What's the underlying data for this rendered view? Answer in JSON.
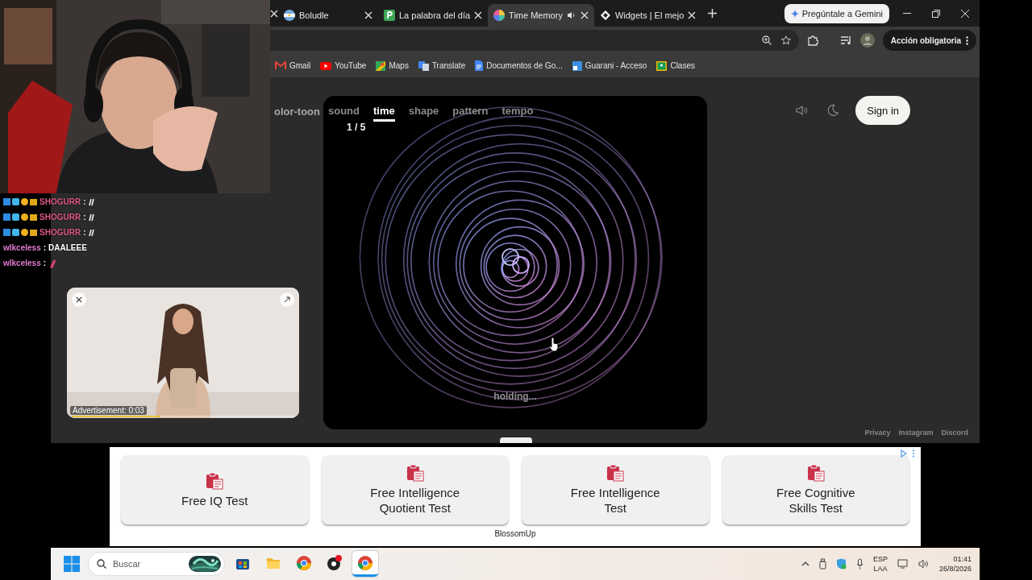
{
  "browser": {
    "tabs": [
      {
        "title": "Boludle",
        "selected": false,
        "audio": false
      },
      {
        "title": "La palabra del día",
        "selected": false,
        "audio": false
      },
      {
        "title": "Time Memory",
        "selected": true,
        "audio": true
      },
      {
        "title": "Widgets | El mejo",
        "selected": false,
        "audio": false
      }
    ],
    "gemini": "Pregúntale a Gemini",
    "action": "Acción obligatoria",
    "bookmarks": [
      "Gmail",
      "YouTube",
      "Maps",
      "Translate",
      "Documentos de Go...",
      "Guarani - Acceso",
      "Clases"
    ]
  },
  "game": {
    "logo": "olor-toon",
    "modes": [
      {
        "label": "sound",
        "selected": false
      },
      {
        "label": "time",
        "selected": true
      },
      {
        "label": "shape",
        "selected": false
      },
      {
        "label": "pattern",
        "selected": false
      },
      {
        "label": "tempo",
        "selected": false
      }
    ],
    "counter": "1 / 5",
    "status": "holding...",
    "sign_in": "Sign in",
    "footer_links": [
      "Privacy",
      "Instagram",
      "Discord"
    ]
  },
  "chat": [
    {
      "user": "SHOGURR",
      "separator": ":",
      "color": "#e0588a",
      "badges": true,
      "kind": "emote"
    },
    {
      "user": "SHOGURR",
      "separator": ":",
      "color": "#e0588a",
      "badges": true,
      "kind": "emote"
    },
    {
      "user": "SHOGURR",
      "separator": ":",
      "color": "#e0588a",
      "badges": true,
      "kind": "emote"
    },
    {
      "user": "wlkceless",
      "separator": ":",
      "color": "#e07ad0",
      "badges": false,
      "kind": "text",
      "message": "DAALEEE"
    },
    {
      "user": "wlkceless",
      "separator": ":",
      "color": "#e07ad0",
      "badges": false,
      "kind": "emote"
    }
  ],
  "video_ad": {
    "label": "Advertisement: 0:03",
    "level": 0.4
  },
  "banner_ad": {
    "cards": [
      "Free IQ Test",
      "Free Intelligence Quotient Test",
      "Free Intelligence Test",
      "Free Cognitive Skills Test"
    ],
    "advertiser": "BlossomUp"
  },
  "taskbar": {
    "search_placeholder": "Buscar",
    "apps": [
      {
        "selected": false
      },
      {
        "selected": false
      },
      {
        "selected": false
      },
      {
        "selected": false
      },
      {
        "selected": true
      }
    ],
    "language": "ESP",
    "layout": "LAA",
    "time": "01:41",
    "date": "26/8/2026"
  }
}
